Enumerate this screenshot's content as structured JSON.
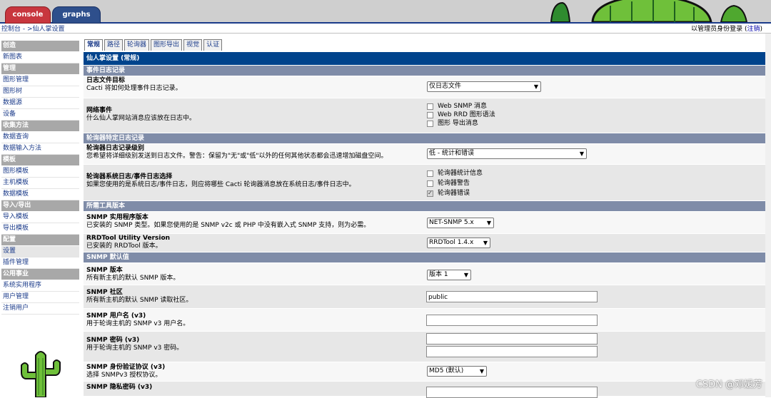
{
  "app_tabs": {
    "console": "console",
    "graphs": "graphs"
  },
  "breadcrumb": {
    "home": "控制台",
    "separator": " - >",
    "current": "仙人掌设置"
  },
  "login": {
    "text": "以管理员身份登录",
    "logout_open": "(",
    "logout": "注销",
    "logout_close": ")"
  },
  "sidebar": [
    {
      "type": "head",
      "label": "创造"
    },
    {
      "type": "item",
      "label": "新图表"
    },
    {
      "type": "head",
      "label": "管理"
    },
    {
      "type": "item",
      "label": "图形管理"
    },
    {
      "type": "item",
      "label": "图形树"
    },
    {
      "type": "item",
      "label": "数据源"
    },
    {
      "type": "item",
      "label": "设备"
    },
    {
      "type": "head",
      "label": "收集方法"
    },
    {
      "type": "item",
      "label": "数据查询"
    },
    {
      "type": "item",
      "label": "数据输入方法"
    },
    {
      "type": "head",
      "label": "模板"
    },
    {
      "type": "item",
      "label": "图形模板"
    },
    {
      "type": "item",
      "label": "主机模板"
    },
    {
      "type": "item",
      "label": "数据模板"
    },
    {
      "type": "head",
      "label": "导入/导出"
    },
    {
      "type": "item",
      "label": "导入模板"
    },
    {
      "type": "item",
      "label": "导出模板"
    },
    {
      "type": "head",
      "label": "配置"
    },
    {
      "type": "item",
      "label": "设置",
      "selected": true
    },
    {
      "type": "item",
      "label": "插件管理"
    },
    {
      "type": "head",
      "label": "公用事业"
    },
    {
      "type": "item",
      "label": "系统实用程序"
    },
    {
      "type": "item",
      "label": "用户管理"
    },
    {
      "type": "item",
      "label": "注销用户"
    }
  ],
  "content_tabs": [
    "常规",
    "路径",
    "轮询器",
    "图形导出",
    "视觉",
    "认证"
  ],
  "active_tab": 0,
  "page_title": "仙人掌设置 (常规)",
  "sections": {
    "event_log": "事件日志记录",
    "poller_log": "轮询器特定日志记录",
    "tools": "所需工具版本",
    "snmp": "SNMP 默认值"
  },
  "rows": {
    "log_dest": {
      "title": "日志文件目标",
      "desc": "Cacti 将如何处理事件日志记录。",
      "value": "仅日志文件"
    },
    "web_events": {
      "title": "网络事件",
      "desc": "什么仙人掌网站消息应该放在日志中。",
      "options": [
        "Web SNMP 消息",
        "Web RRD 图形语法",
        "图形 导出消息"
      ]
    },
    "poller_level": {
      "title": "轮询器日志记录级别",
      "desc": "您希望将详细级别发送到日志文件。警告：保留为\"无\"或\"低\"以外的任何其他状态都会迅速增加磁盘空间。",
      "value": "低 - 统计和错误"
    },
    "poller_syslog": {
      "title": "轮询器系统日志/事件日志选择",
      "desc": "如果您使用的是系统日志/事件日志，则应将哪些 Cacti 轮询器消息放在系统日志/事件日志中。",
      "options": [
        "轮询器统计信息",
        "轮询器警告",
        "轮询器错误"
      ]
    },
    "snmp_util": {
      "title": "SNMP 实用程序版本",
      "desc": "已安装的 SNMP 类型。如果您使用的是 SNMP v2c 或 PHP 中没有嵌入式 SNMP 支持，则为必需。",
      "value": "NET-SNMP 5.x"
    },
    "rrdtool": {
      "title": "RRDTool Utility Version",
      "desc": "已安装的 RRDTool 版本。",
      "value": "RRDTool 1.4.x"
    },
    "snmp_ver": {
      "title": "SNMP 版本",
      "desc": "所有新主机的默认 SNMP 版本。",
      "value": "版本 1"
    },
    "snmp_comm": {
      "title": "SNMP 社区",
      "desc": "所有新主机的默认 SNMP 读取社区。",
      "value": "public"
    },
    "snmp_user": {
      "title": "SNMP 用户名 (v3)",
      "desc": "用于轮询主机的 SNMP v3 用户名。"
    },
    "snmp_pass": {
      "title": "SNMP 密码 (v3)",
      "desc": "用于轮询主机的 SNMP v3 密码。"
    },
    "snmp_auth": {
      "title": "SNMP 身份验证协议 (v3)",
      "desc": "选择 SNMPv3 授权协议。",
      "value": "MD5 (默认)"
    },
    "snmp_priv": {
      "title": "SNMP 隐私密码 (v3)"
    }
  },
  "watermark": "CSDN @邓媛芳"
}
